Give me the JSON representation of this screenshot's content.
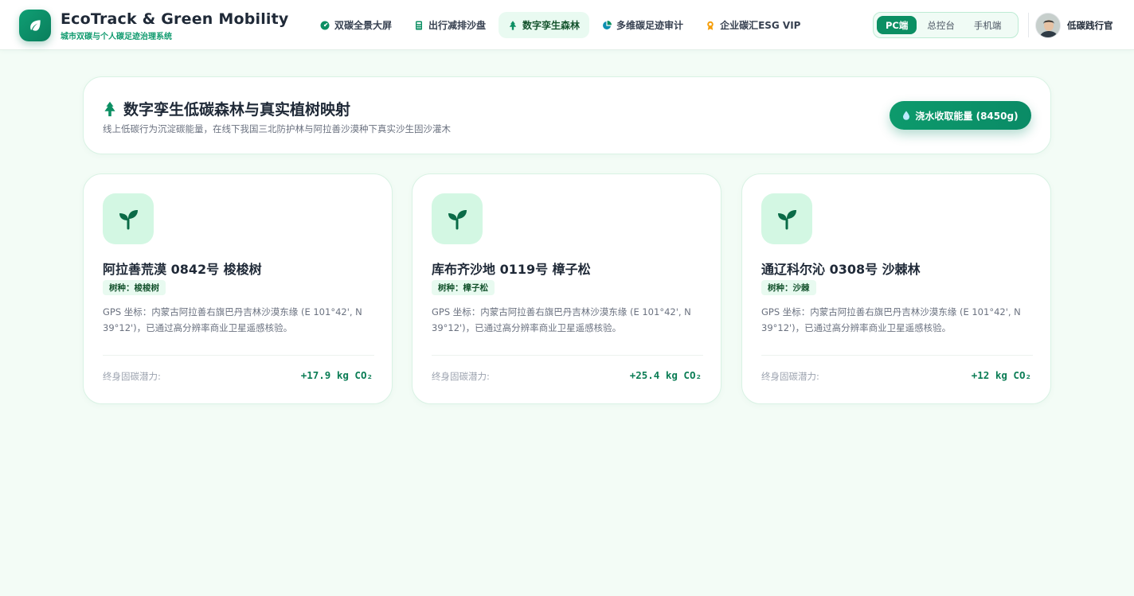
{
  "header": {
    "brand_title": "EcoTrack & Green Mobility",
    "brand_subtitle": "城市双碳与个人碳足迹治理系统",
    "logo_icon": "leaf-icon",
    "nav": [
      {
        "label": "双碳全景大屏",
        "icon": "gauge-icon",
        "active": false
      },
      {
        "label": "出行减排沙盘",
        "icon": "calculator-icon",
        "active": false
      },
      {
        "label": "数字孪生森林",
        "icon": "tree-icon",
        "active": true
      },
      {
        "label": "多维碳足迹审计",
        "icon": "pie-chart-icon",
        "active": false
      },
      {
        "label": "企业碳汇ESG VIP",
        "icon": "award-icon",
        "active": false
      }
    ],
    "platform_switch": [
      {
        "label": "PC端",
        "active": true
      },
      {
        "label": "总控台",
        "active": false
      },
      {
        "label": "手机端",
        "active": false
      }
    ],
    "user_name": "低碳践行官"
  },
  "page": {
    "title": "数字孪生低碳森林与真实植树映射",
    "title_icon": "tree-icon",
    "description": "线上低碳行为沉淀碳能量，在线下我国三北防护林与阿拉善沙漠种下真实沙生固沙灌木",
    "water_button": "浇水收取能量 (8450g)",
    "water_icon": "droplet-icon"
  },
  "trees": [
    {
      "name": "阿拉善荒漠 0842号 梭梭树",
      "species": "树种：梭梭树",
      "gps": "GPS 坐标：内蒙古阿拉善右旗巴丹吉林沙漠东缘 (E 101°42', N 39°12')，已通过高分辨率商业卫星遥感核验。",
      "potential_label": "终身固碳潜力:",
      "potential_value": "+17.9 kg CO₂"
    },
    {
      "name": "库布齐沙地 0119号 樟子松",
      "species": "树种：樟子松",
      "gps": "GPS 坐标：内蒙古阿拉善右旗巴丹吉林沙漠东缘 (E 101°42', N 39°12')，已通过高分辨率商业卫星遥感核验。",
      "potential_label": "终身固碳潜力:",
      "potential_value": "+25.4 kg CO₂"
    },
    {
      "name": "通辽科尔沁 0308号 沙棘林",
      "species": "树种：沙棘",
      "gps": "GPS 坐标：内蒙古阿拉善右旗巴丹吉林沙漠东缘 (E 101°42', N 39°12')，已通过高分辨率商业卫星遥感核验。",
      "potential_label": "终身固碳潜力:",
      "potential_value": "+12 kg CO₂"
    }
  ],
  "colors": {
    "accent": "#0c8f63",
    "accent_light": "#d3f7e3",
    "page_bg": "#f3fcf6",
    "award_icon": "#f59e0b"
  }
}
